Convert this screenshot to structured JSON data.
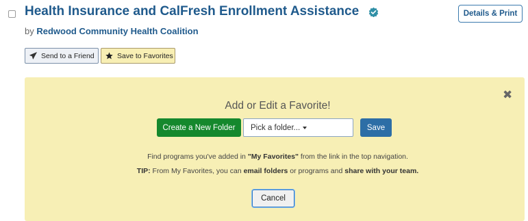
{
  "listing": {
    "title": "Health Insurance and CalFresh Enrollment Assistance",
    "by_prefix": "by",
    "organization": "Redwood Community Health Coalition",
    "details_print_label": "Details & Print",
    "send_label": "Send to a Friend",
    "save_favorites_label": "Save to Favorites",
    "verified_icon": "verified-badge-icon",
    "select_checked": false
  },
  "favorite_panel": {
    "heading": "Add or Edit a Favorite!",
    "create_folder_label": "Create a New Folder",
    "folder_select_value": "Pick a folder...",
    "save_label": "Save",
    "cancel_label": "Cancel",
    "close_icon": "close-icon",
    "info_line1": {
      "text_before": "Find programs you've added in ",
      "highlight": "\"My Favorites\"",
      "text_after": " from the link in the top navigation."
    },
    "info_line2": {
      "tip": "TIP:",
      "text1": " From My Favorites, you can ",
      "bold1": "email folders",
      "text2": " or programs and ",
      "bold2": "share with your team."
    }
  },
  "colors": {
    "title": "#1f5a8c",
    "panel_bg": "#f7efb5",
    "create_folder_bg": "#15882d",
    "save_bg": "#2d6ea6"
  }
}
